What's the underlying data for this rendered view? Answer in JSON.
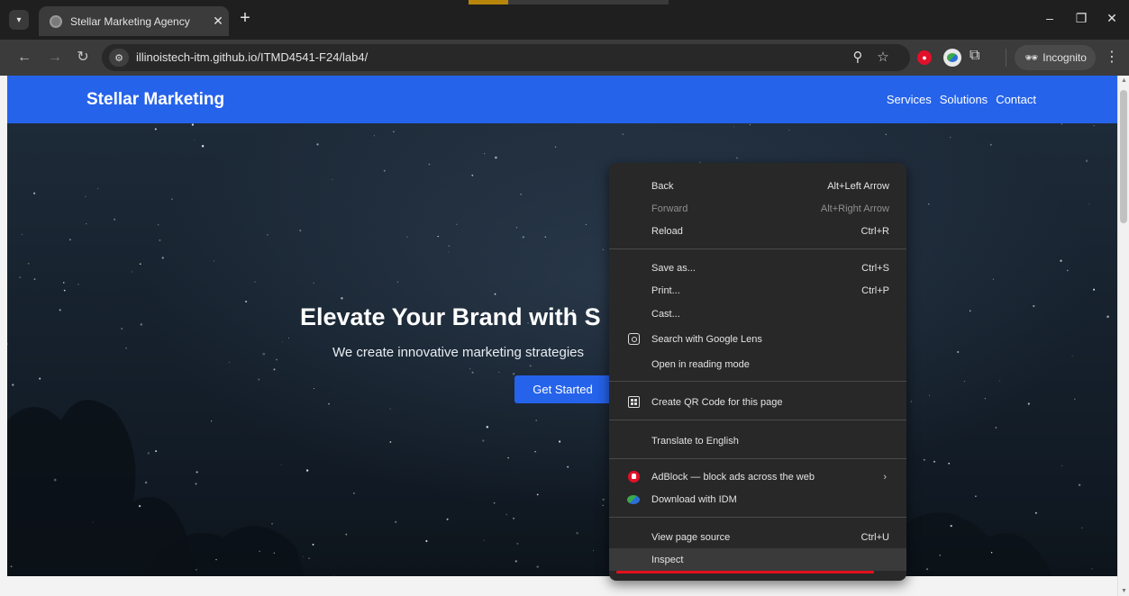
{
  "browser": {
    "tab": {
      "title": "Stellar Marketing Agency"
    },
    "toolbar": {
      "url": "illinoistech-itm.github.io/ITMD4541-F24/lab4/",
      "incognito_label": "Incognito"
    },
    "icons": {
      "tab_menu": "▾",
      "close_tab": "✕",
      "new_tab": "+",
      "minimize": "–",
      "restore": "❐",
      "close_window": "✕",
      "back": "←",
      "forward": "→",
      "reload": "↻",
      "site_info": "⚙",
      "zoom": "⚲",
      "bookmark": "☆",
      "extensions": "⧉",
      "incognito": "🕶",
      "menu": "⋮"
    }
  },
  "site": {
    "brand": "Stellar Marketing",
    "nav_links": [
      "Services",
      "Solutions",
      "Contact"
    ],
    "hero": {
      "title": "Elevate Your Brand with S",
      "subtitle": "We create innovative marketing strategies",
      "cta": "Get Started"
    }
  },
  "context_menu": {
    "items": [
      {
        "label": "Back",
        "shortcut": "Alt+Left Arrow"
      },
      {
        "label": "Forward",
        "shortcut": "Alt+Right Arrow",
        "disabled": true
      },
      {
        "label": "Reload",
        "shortcut": "Ctrl+R"
      },
      {
        "label": "Save as...",
        "shortcut": "Ctrl+S"
      },
      {
        "label": "Print...",
        "shortcut": "Ctrl+P"
      },
      {
        "label": "Cast..."
      },
      {
        "label": "Search with Google Lens",
        "icon": "lens-icon"
      },
      {
        "label": "Open in reading mode"
      },
      {
        "label": "Create QR Code for this page",
        "icon": "qr-code-icon"
      },
      {
        "label": "Translate to English"
      },
      {
        "label": "AdBlock — block ads across the web",
        "icon": "adblock-icon",
        "submenu": "›"
      },
      {
        "label": "Download with IDM",
        "icon": "idm-icon"
      },
      {
        "label": "View page source",
        "shortcut": "Ctrl+U"
      },
      {
        "label": "Inspect",
        "highlighted": true
      }
    ]
  },
  "colors": {
    "brand_blue": "#2563eb",
    "browser_dark": "#1f1f1f",
    "menu_bg": "#282828",
    "highlight_red": "#e3101c"
  }
}
